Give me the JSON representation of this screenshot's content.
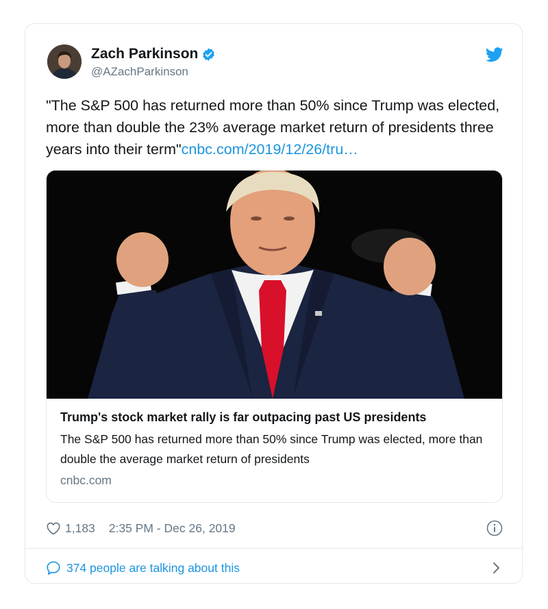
{
  "tweet": {
    "author": {
      "display_name": "Zach Parkinson",
      "handle": "@AZachParkinson",
      "verified": true
    },
    "text": "\"The S&P 500 has returned more than 50% since Trump was elected, more than double the 23% average market return of presidents three years into their term\"",
    "link": "cnbc.com/2019/12/26/tru…",
    "card": {
      "title": "Trump's stock market rally is far outpacing past US presidents",
      "description": "The S&P 500 has returned more than 50% since Trump was elected, more than double the average market return of presidents",
      "domain": "cnbc.com"
    },
    "likes": "1,183",
    "timestamp": "2:35 PM - Dec 26, 2019",
    "conversation": "374 people are talking about this"
  },
  "colors": {
    "link": "#1b95e0",
    "verified": "#1da1f2",
    "muted": "#657786",
    "border": "#e1e8ed",
    "tie": "#d8102a",
    "suit": "#1b2440"
  },
  "icons": [
    "avatar",
    "verified-badge-icon",
    "twitter-bird-icon",
    "heart-icon",
    "info-icon",
    "speech-bubble-icon",
    "chevron-right-icon"
  ]
}
